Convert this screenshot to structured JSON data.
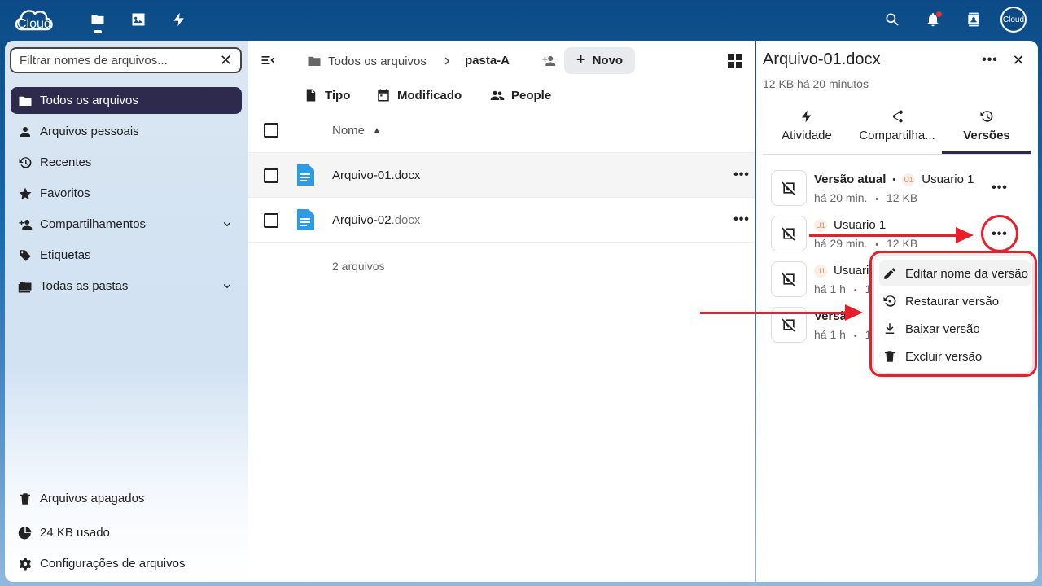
{
  "topbar": {
    "logo_text": "Cloud",
    "avatar_text": "Cloud",
    "apps": [
      "folder-icon",
      "image-icon",
      "lightning-icon"
    ],
    "right_icons": [
      "search-icon",
      "bell-icon",
      "contacts-icon"
    ]
  },
  "nav": {
    "filter_placeholder": "Filtrar nomes de arquivos...",
    "items": [
      {
        "label": "Todos os arquivos",
        "icon": "folder-icon",
        "active": true
      },
      {
        "label": "Arquivos pessoais",
        "icon": "person-icon"
      },
      {
        "label": "Recentes",
        "icon": "history-icon"
      },
      {
        "label": "Favoritos",
        "icon": "star-icon"
      },
      {
        "label": "Compartilhamentos",
        "icon": "share-person-icon",
        "expandable": true
      },
      {
        "label": "Etiquetas",
        "icon": "tag-icon"
      },
      {
        "label": "Todas as pastas",
        "icon": "folders-icon",
        "expandable": true
      }
    ],
    "bottom": [
      {
        "label": "Arquivos apagados",
        "icon": "trash-icon"
      },
      {
        "label": "24 KB usado",
        "icon": "pie-icon"
      },
      {
        "label": "Configurações de arquivos",
        "icon": "gear-icon"
      }
    ]
  },
  "main": {
    "breadcrumb": {
      "root": "Todos os arquivos",
      "current": "pasta-A"
    },
    "new_label": "Novo",
    "filters": [
      "Tipo",
      "Modificado",
      "People"
    ],
    "column_name": "Nome",
    "files": [
      {
        "base": "Arquivo-01",
        "ext": ".docx"
      },
      {
        "base": "Arquivo-02",
        "ext": ".docx"
      }
    ],
    "summary": "2 arquivos"
  },
  "sidebar": {
    "title": "Arquivo-01.docx",
    "subtitle": "12 KB há 20 minutos",
    "tabs": [
      {
        "label": "Atividade",
        "icon": "lightning-icon"
      },
      {
        "label": "Compartilha...",
        "icon": "share-icon"
      },
      {
        "label": "Versões",
        "icon": "history-icon",
        "active": true
      }
    ],
    "versions": [
      {
        "label": "Versão atual",
        "author": "Usuario 1",
        "badge": "U1",
        "time": "há 20 min.",
        "size": "12 KB"
      },
      {
        "label": "",
        "author": "Usuario 1",
        "badge": "U1",
        "time": "há 29 min.",
        "size": "12 KB"
      },
      {
        "label": "",
        "author": "Usuari",
        "badge": "U1",
        "time": "há 1 h",
        "size": "1"
      },
      {
        "label": "Versã",
        "author": "",
        "badge": "",
        "time": "há 1 h",
        "size": "1"
      }
    ],
    "version_bullet": "•"
  },
  "menu": {
    "items": [
      {
        "label": "Editar nome da versão",
        "icon": "pencil-icon"
      },
      {
        "label": "Restaurar versão",
        "icon": "restore-icon"
      },
      {
        "label": "Baixar versão",
        "icon": "download-icon"
      },
      {
        "label": "Excluir versão",
        "icon": "trash-icon"
      }
    ]
  },
  "colors": {
    "accent": "#2e2a4d",
    "annotation": "#e81f2b",
    "header": "#0b4a86"
  }
}
